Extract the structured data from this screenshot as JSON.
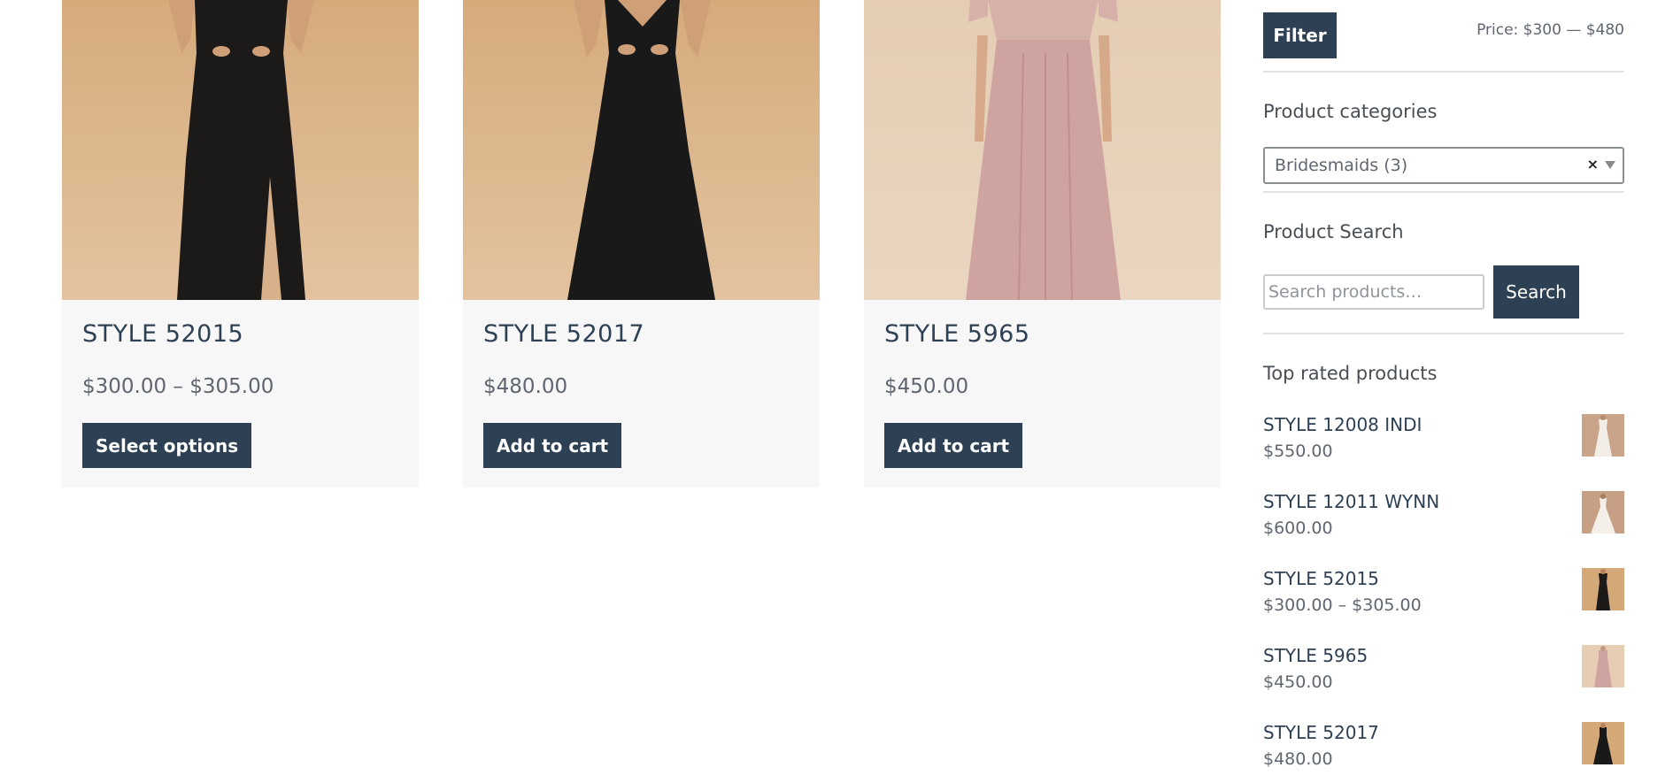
{
  "products": [
    {
      "title": "STYLE 52015",
      "price": "$300.00 – $305.00",
      "button": "Select options",
      "image": "black-gown-slit"
    },
    {
      "title": "STYLE 52017",
      "price": "$480.00",
      "button": "Add to cart",
      "image": "black-gown-lace"
    },
    {
      "title": "STYLE 5965",
      "price": "$450.00",
      "button": "Add to cart",
      "image": "blush-gown-lace"
    }
  ],
  "sidebar": {
    "filter_button": "Filter",
    "price_range": "Price: $300 — $480",
    "categories_heading": "Product categories",
    "category_selected": "Bridesmaids  (3)",
    "clear_symbol": "×",
    "search_heading": "Product Search",
    "search_placeholder": "Search products…",
    "search_button": "Search",
    "top_rated_heading": "Top rated products",
    "top_rated": [
      {
        "title": "STYLE 12008 INDI",
        "price": "$550.00",
        "image": "white-gown"
      },
      {
        "title": "STYLE 12011 WYNN",
        "price": "$600.00",
        "image": "white-gown"
      },
      {
        "title": "STYLE 52015",
        "price": "$300.00 – $305.00",
        "image": "black-gown"
      },
      {
        "title": "STYLE 5965",
        "price": "$450.00",
        "image": "blush-gown"
      },
      {
        "title": "STYLE 52017",
        "price": "$480.00",
        "image": "black-gown"
      }
    ]
  },
  "colors": {
    "accent": "#2e4053",
    "card_bg": "#f7f7f7",
    "photo_bg": "#d9b48a"
  }
}
